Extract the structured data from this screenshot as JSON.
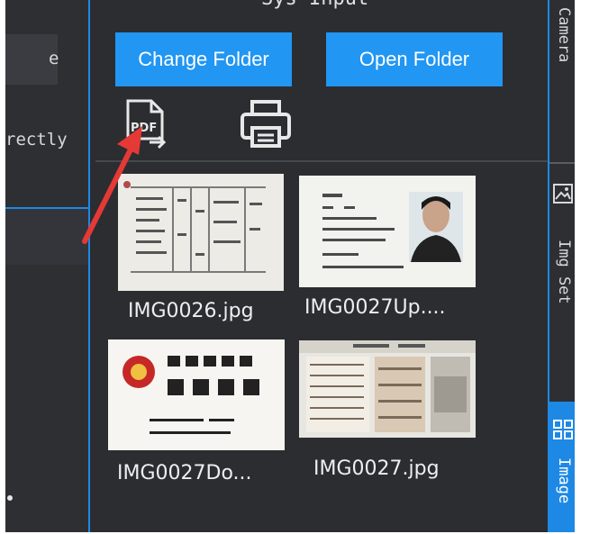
{
  "left_panel": {
    "truncated_label_1": "e",
    "truncated_label_2": "rectly"
  },
  "center": {
    "title_fragment": "Sys Input",
    "change_folder_label": "Change Folder",
    "open_folder_label": "Open Folder",
    "pdf_icon": "pdf-export-icon",
    "print_icon": "printer-icon",
    "pdf_icon_text": "PDF",
    "thumbnails": [
      {
        "filename": "IMG0026.jpg"
      },
      {
        "filename": "IMG0027Up...."
      },
      {
        "filename": "IMG0027Do..."
      },
      {
        "filename": "IMG0027.jpg"
      }
    ]
  },
  "right_sidebar": {
    "tab_camera": "Camera",
    "tab_img_set": "Img Set",
    "tab_image": "Image",
    "img_set_icon": "picture-icon",
    "image_icon": "grid-icon"
  },
  "annotation": {
    "arrow_color": "#e53935"
  },
  "colors": {
    "accent": "#2196f3",
    "panel": "#2b2d31"
  }
}
